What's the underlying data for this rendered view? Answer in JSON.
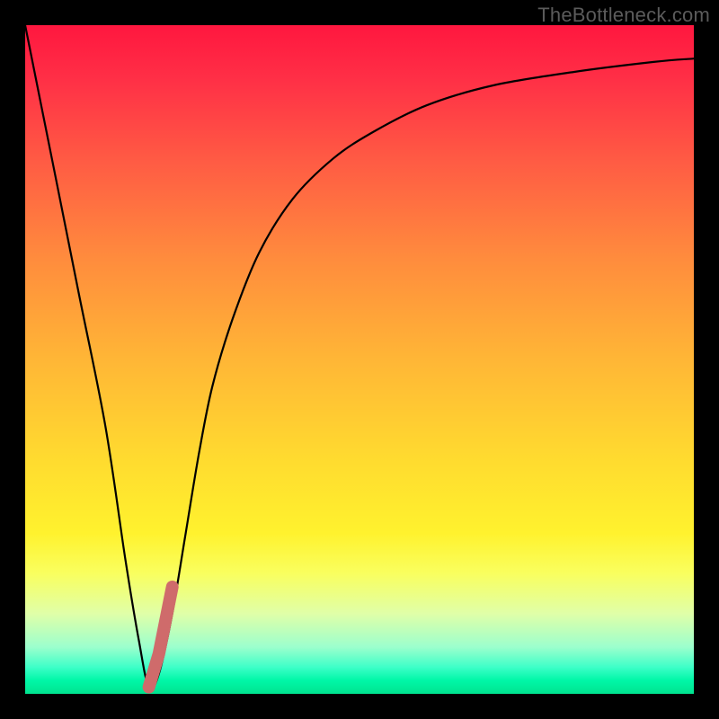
{
  "watermark": "TheBottleneck.com",
  "chart_data": {
    "type": "line",
    "title": "",
    "xlabel": "",
    "ylabel": "",
    "xlim": [
      0,
      100
    ],
    "ylim": [
      0,
      100
    ],
    "grid": false,
    "legend": false,
    "series": [
      {
        "name": "bottleneck-curve",
        "color": "#000000",
        "x": [
          0,
          4,
          8,
          12,
          15,
          17,
          18.5,
          20,
          22,
          24,
          26,
          28,
          31,
          35,
          40,
          46,
          52,
          60,
          70,
          82,
          94,
          100
        ],
        "y": [
          100,
          80,
          60,
          40,
          20,
          8,
          1,
          3,
          12,
          24,
          36,
          46,
          56,
          66,
          74,
          80,
          84,
          88,
          91,
          93,
          94.5,
          95
        ]
      },
      {
        "name": "highlight-segment",
        "color": "#cf6b6b",
        "x": [
          18.5,
          20,
          22
        ],
        "y": [
          1,
          6,
          16
        ]
      }
    ],
    "gradient_scale": {
      "description": "vertical color gradient indicating bottleneck severity, red=high green=low",
      "stops": [
        {
          "pos": 0.0,
          "color": "#ff173f"
        },
        {
          "pos": 0.5,
          "color": "#ffb636"
        },
        {
          "pos": 0.8,
          "color": "#fff22e"
        },
        {
          "pos": 1.0,
          "color": "#00e38f"
        }
      ]
    }
  }
}
